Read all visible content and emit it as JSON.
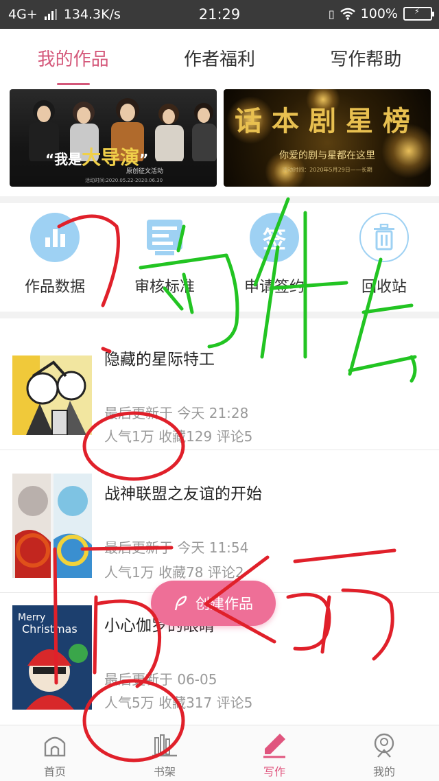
{
  "status_bar": {
    "network": "4G+",
    "speed": "134.3K/s",
    "time": "21:29",
    "battery": "100%"
  },
  "tabs": [
    {
      "label": "我的作品",
      "active": true
    },
    {
      "label": "作者福利",
      "active": false
    },
    {
      "label": "写作帮助",
      "active": false
    }
  ],
  "banners": {
    "left": {
      "prefix": "“我是",
      "highlight": "大导演",
      "suffix": "”",
      "sub": "原创征文活动",
      "foot": "活动时间:2020.05.22-2020.06.30"
    },
    "right": {
      "title": "话本剧星榜",
      "sub": "你爱的剧与星都在这里",
      "foot": "活动时间：2020年5月29日——长期"
    }
  },
  "quick_actions": [
    {
      "label": "作品数据",
      "icon": "bar-chart-icon"
    },
    {
      "label": "审核标准",
      "icon": "review-doc-icon"
    },
    {
      "label": "申请签约",
      "icon": "sign-icon",
      "icon_text": "签"
    },
    {
      "label": "回收站",
      "icon": "trash-icon"
    }
  ],
  "works": [
    {
      "title": "隐藏的星际特工",
      "updated": "最后更新于 今天 21:28",
      "stats": "人气1万  收藏129  评论5"
    },
    {
      "title": "战神联盟之友谊的开始",
      "updated": "最后更新于 今天 11:54",
      "stats": "人气1万  收藏78  评论2"
    },
    {
      "title": "小心伽罗的眼睛",
      "updated": "最后更新于 06-05",
      "stats": "人气5万  收藏317  评论5"
    }
  ],
  "create_button": {
    "label": "创建作品",
    "icon": "feather-icon"
  },
  "bottom_nav": [
    {
      "label": "首页",
      "icon": "home-icon",
      "active": false
    },
    {
      "label": "书架",
      "icon": "bookshelf-icon",
      "active": false
    },
    {
      "label": "写作",
      "icon": "pen-icon",
      "active": true
    },
    {
      "label": "我的",
      "icon": "profile-icon",
      "active": false
    }
  ],
  "colors": {
    "accent": "#d4587a",
    "create_button": "#ee6f97",
    "icon_blue": "#9ed1f3",
    "annotation_red": "#e0202a",
    "annotation_green": "#22c422"
  }
}
